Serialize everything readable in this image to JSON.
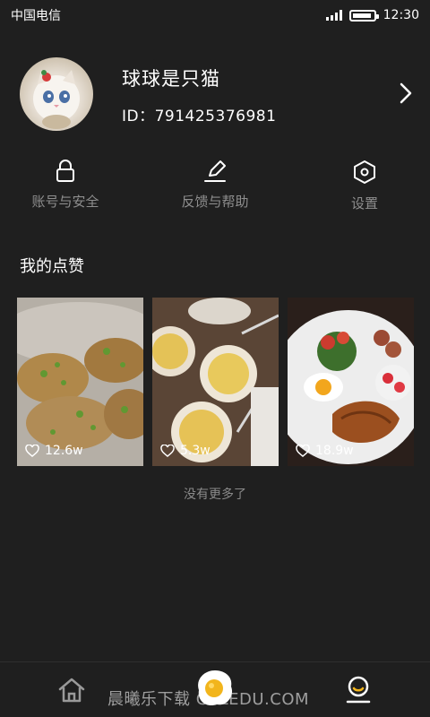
{
  "status_bar": {
    "carrier": "中国电信",
    "time": "12:30"
  },
  "profile": {
    "name": "球球是只猫",
    "id_text": "ID：791425376981"
  },
  "quick_actions": [
    {
      "label": "账号与安全",
      "icon": "lock-icon"
    },
    {
      "label": "反馈与帮助",
      "icon": "edit-icon"
    },
    {
      "label": "设置",
      "icon": "settings-icon"
    }
  ],
  "liked_section": {
    "title": "我的点赞"
  },
  "cards": [
    {
      "likes": "12.6w"
    },
    {
      "likes": "5.3w"
    },
    {
      "likes": "18.9w"
    }
  ],
  "list_footer": "没有更多了",
  "watermark": "晨曦乐下载 CXLEDU.COM",
  "colors": {
    "background": "#1f1f1f",
    "muted_text": "#8e8e8e"
  }
}
